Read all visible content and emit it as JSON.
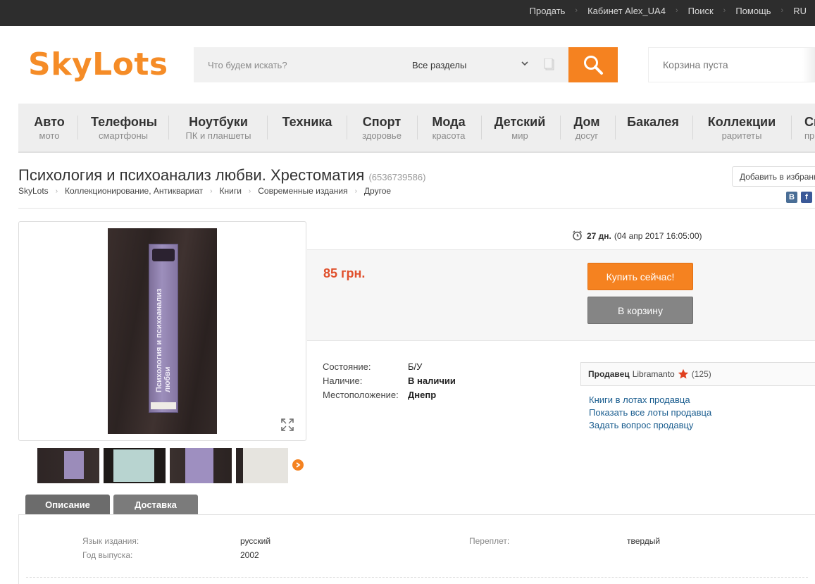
{
  "topbar": {
    "links": [
      "Продать",
      "Кабинет Alex_UA4",
      "Поиск",
      "Помощь",
      "RU"
    ]
  },
  "header": {
    "logo": "SkyLots",
    "search_placeholder": "Что будем искать?",
    "section_select": "Все разделы",
    "cart_text": "Корзина пуста"
  },
  "categories": [
    {
      "title": "Авто",
      "sub": "мото"
    },
    {
      "title": "Телефоны",
      "sub": "смартфоны"
    },
    {
      "title": "Ноутбуки",
      "sub": "ПК и планшеты"
    },
    {
      "title": "Техника",
      "sub": ""
    },
    {
      "title": "Спорт",
      "sub": "здоровье"
    },
    {
      "title": "Мода",
      "sub": "красота"
    },
    {
      "title": "Детский",
      "sub": "мир"
    },
    {
      "title": "Дом",
      "sub": "досуг"
    },
    {
      "title": "Бакалея",
      "sub": ""
    },
    {
      "title": "Коллекции",
      "sub": "раритеты"
    },
    {
      "title": "Сп",
      "sub": "пр"
    }
  ],
  "product": {
    "title": "Психология и психоанализ любви. Хрестоматия",
    "id": "(6536739586)",
    "breadcrumbs": [
      "SkyLots",
      "Коллекционирование, Антиквариат",
      "Книги",
      "Современные издания",
      "Другое"
    ],
    "fav_button": "Добавить в избранное",
    "cover_text": "Психология и психоанализ любви",
    "timer_days": "27 дн.",
    "timer_date": "(04 апр 2017 16:05:00)",
    "price": "85 грн.",
    "buy_now": "Купить сейчас!",
    "add_to_cart": "В корзину",
    "props": [
      {
        "key": "Состояние:",
        "value": "Б/У"
      },
      {
        "key": "Наличие:",
        "value": "В наличии"
      },
      {
        "key": "Местоположение:",
        "value": "Днепр"
      }
    ]
  },
  "seller": {
    "label": "Продавец",
    "name": "Libramanto",
    "rating": "(125)",
    "links": [
      "Книги в лотах продавца",
      "Показать все лоты продавца",
      "Задать вопрос продавцу"
    ]
  },
  "tabs": [
    "Описание",
    "Доставка"
  ],
  "description": {
    "rows": [
      {
        "key": "Язык издания:",
        "value": "русский"
      },
      {
        "key": "Год выпуска:",
        "value": "2002"
      },
      {
        "key": "Переплет:",
        "value": "твердый"
      }
    ]
  },
  "colors": {
    "accent": "#f58220",
    "price": "#e0502c",
    "link": "#1a5d8f",
    "topbar": "#2d2d2d"
  }
}
